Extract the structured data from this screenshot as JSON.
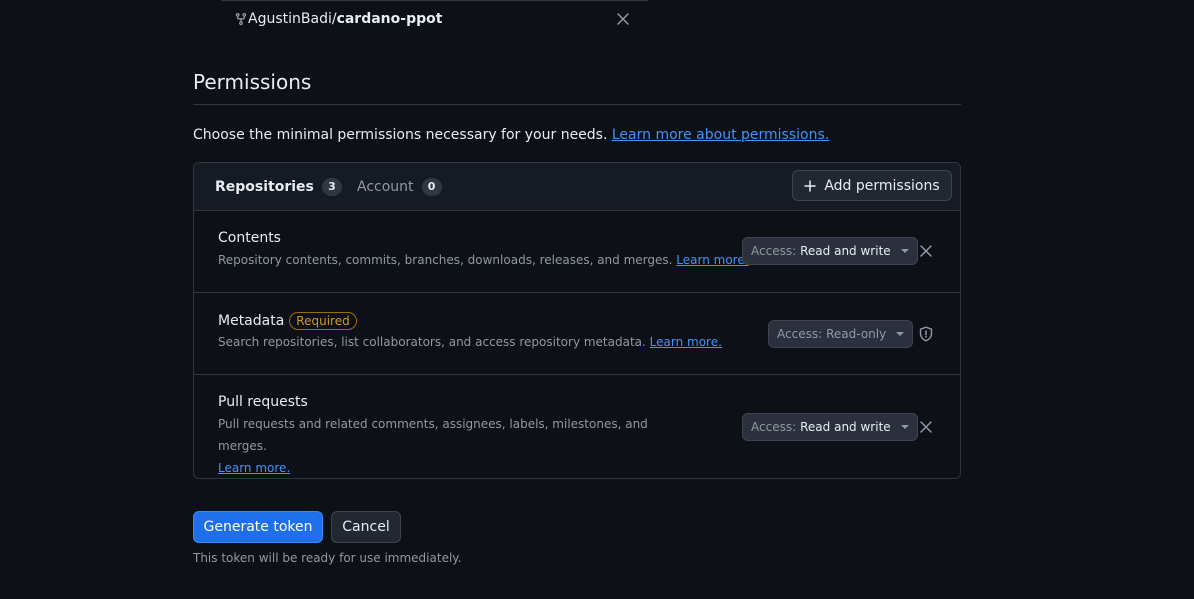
{
  "repo": {
    "owner": "AgustinBadi/",
    "name": "cardano-ppot"
  },
  "permissions": {
    "title": "Permissions",
    "description": "Choose the minimal permissions necessary for your needs.",
    "learn_link": "Learn more about permissions.",
    "tabs": [
      {
        "label": "Repositories",
        "count": "3"
      },
      {
        "label": "Account",
        "count": "0"
      }
    ],
    "add_button": "Add permissions",
    "rows": [
      {
        "name": "Contents",
        "description": "Repository contents, commits, branches, downloads, releases, and merges.",
        "learn": "Learn more.",
        "access_label": "Access:",
        "access_value": "Read and write"
      },
      {
        "name": "Metadata",
        "badge": "Required",
        "description": "Search repositories, list collaborators, and access repository metadata.",
        "learn": "Learn more.",
        "access_label": "Access:",
        "access_value": "Read-only"
      },
      {
        "name": "Pull requests",
        "description": "Pull requests and related comments, assignees, labels, milestones, and merges.",
        "learn": "Learn more.",
        "access_label": "Access:",
        "access_value": "Read and write"
      }
    ]
  },
  "actions": {
    "generate": "Generate token",
    "cancel": "Cancel",
    "note": "This token will be ready for use immediately."
  },
  "colors": {
    "background": "#0d1117",
    "primary_button": "#1f6feb",
    "link": "#4493f8",
    "required_badge": "#d29922"
  }
}
